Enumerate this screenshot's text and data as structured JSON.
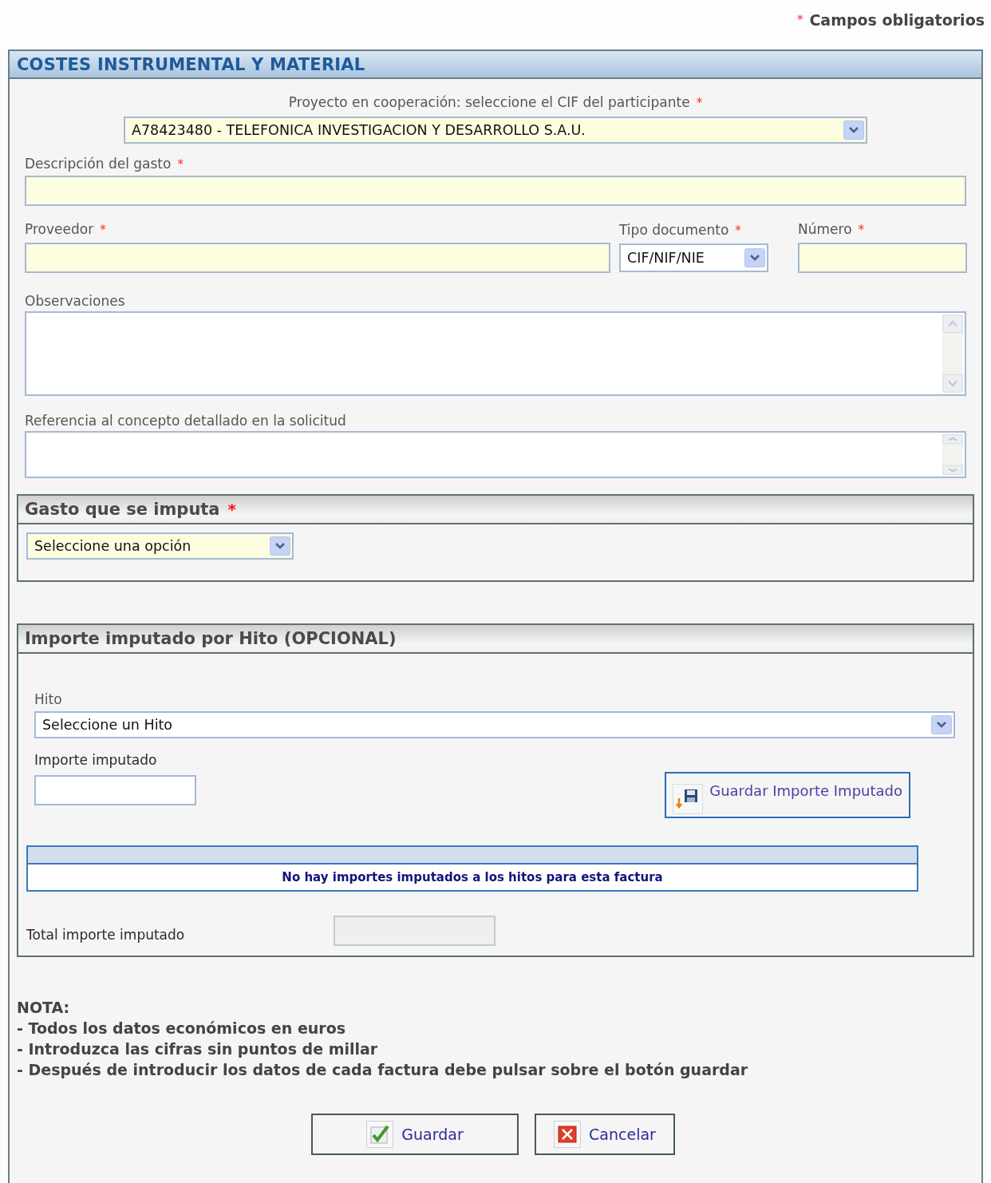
{
  "required_mark": "*",
  "required_note": {
    "label": "Campos obligatorios"
  },
  "panel": {
    "title": "COSTES INSTRUMENTAL Y MATERIAL"
  },
  "participant": {
    "label": "Proyecto en cooperación: seleccione el CIF del participante",
    "required": true,
    "value": "A78423480 - TELEFONICA INVESTIGACION Y DESARROLLO S.A.U."
  },
  "description": {
    "label": "Descripción del gasto",
    "required": true
  },
  "supplier": {
    "label": "Proveedor",
    "required": true
  },
  "document_type": {
    "label": "Tipo documento",
    "required": true,
    "value": "CIF/NIF/NIE"
  },
  "number": {
    "label": "Número",
    "required": true
  },
  "observations": {
    "label": "Observaciones",
    "required": false
  },
  "reference": {
    "label": "Referencia al concepto detallado en la solicitud",
    "required": false
  },
  "expense_section": {
    "title": "Gasto que se imputa",
    "required": true,
    "value": "Seleccione una opción"
  },
  "milestone_section": {
    "title": "Importe imputado por Hito (OPCIONAL)",
    "hito": {
      "label": "Hito",
      "value": "Seleccione un Hito"
    },
    "amount": {
      "label": "Importe imputado"
    },
    "save_button": "Guardar Importe Imputado",
    "table": {
      "empty_message": "No hay importes imputados a los hitos para esta factura"
    },
    "total": {
      "label": "Total importe imputado",
      "disabled": true
    }
  },
  "note": {
    "title": "NOTA:",
    "lines": [
      "- Todos los datos económicos en euros",
      "- Introduzca las cifras sin puntos de millar",
      "- Después de introducir los datos de cada factura debe pulsar sobre el botón guardar"
    ]
  },
  "buttons": [
    {
      "kind": "save",
      "label": "Guardar"
    },
    {
      "kind": "cancel",
      "label": "Cancelar"
    }
  ]
}
